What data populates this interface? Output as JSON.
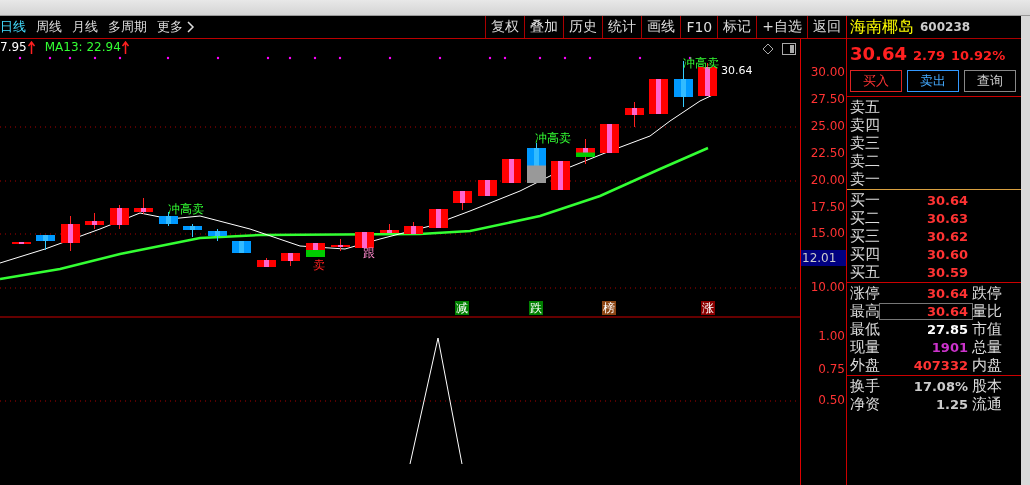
{
  "period_tabs": [
    {
      "label": "日线",
      "selected": true
    },
    {
      "label": "周线",
      "selected": false
    },
    {
      "label": "月线",
      "selected": false
    },
    {
      "label": "多周期",
      "selected": false
    },
    {
      "label": "更多",
      "selected": false
    }
  ],
  "toolbar": [
    "复权",
    "叠加",
    "历史",
    "统计",
    "画线",
    "F10",
    "标记",
    "+自选",
    "返回"
  ],
  "chart": {
    "legend": [
      {
        "text": "7.95",
        "kind": "price"
      },
      {
        "text": "MA13: 22.94",
        "kind": "ma"
      }
    ],
    "last_price": "30.64",
    "price_axis": [
      "30.00",
      "27.50",
      "25.00",
      "22.50",
      "20.00",
      "17.50",
      "15.00",
      "10.00"
    ],
    "current_marker": "12.01",
    "indicator_axis": [
      "1.00",
      "0.75",
      "0.50"
    ],
    "signals": [
      {
        "text": "冲高卖",
        "kind": "sell_high"
      },
      {
        "text": "冲高卖",
        "kind": "sell_high"
      },
      {
        "text": "冲高卖",
        "kind": "sell_high"
      },
      {
        "text": "卖",
        "kind": "sell"
      },
      {
        "text": "跟",
        "kind": "follow"
      }
    ],
    "flags": [
      {
        "text": "减",
        "color": "#008000"
      },
      {
        "text": "跌",
        "color": "#008000"
      },
      {
        "text": "榜",
        "color": "#8b4513"
      },
      {
        "text": "涨",
        "color": "#8b0000"
      }
    ]
  },
  "stock": {
    "name": "海南椰岛",
    "code": "600238",
    "price": "30.64",
    "change": "2.79",
    "change_pct": "10.92%"
  },
  "trade_buttons": [
    {
      "label": "买入",
      "kind": "buy"
    },
    {
      "label": "卖出",
      "kind": "sell"
    },
    {
      "label": "查询",
      "kind": "query"
    }
  ],
  "asks": [
    "卖五",
    "卖四",
    "卖三",
    "卖二",
    "卖一"
  ],
  "bids": [
    {
      "label": "买一",
      "price": "30.64"
    },
    {
      "label": "买二",
      "price": "30.63"
    },
    {
      "label": "买三",
      "price": "30.62"
    },
    {
      "label": "买四",
      "price": "30.60"
    },
    {
      "label": "买五",
      "price": "30.59"
    }
  ],
  "stats": [
    {
      "label": "涨停",
      "value": "30.64",
      "kind": "up",
      "boxed": false,
      "label_2": "跌停"
    },
    {
      "label": "最高",
      "value": "30.64",
      "kind": "up",
      "boxed": true,
      "label_2": "量比"
    },
    {
      "label": "最低",
      "value": "27.85",
      "kind": "flat",
      "boxed": false,
      "label_2": "市值"
    },
    {
      "label": "现量",
      "value": "1901",
      "kind": "volume",
      "boxed": false,
      "label_2": "总量"
    },
    {
      "label": "外盘",
      "value": "407332",
      "kind": "up",
      "boxed": false,
      "label_2": "内盘"
    }
  ],
  "stats_2": [
    {
      "label": "换手",
      "value": "17.08%",
      "label_2": "股本"
    },
    {
      "label": "净资",
      "value": "1.25",
      "label_2": "流通"
    }
  ]
}
